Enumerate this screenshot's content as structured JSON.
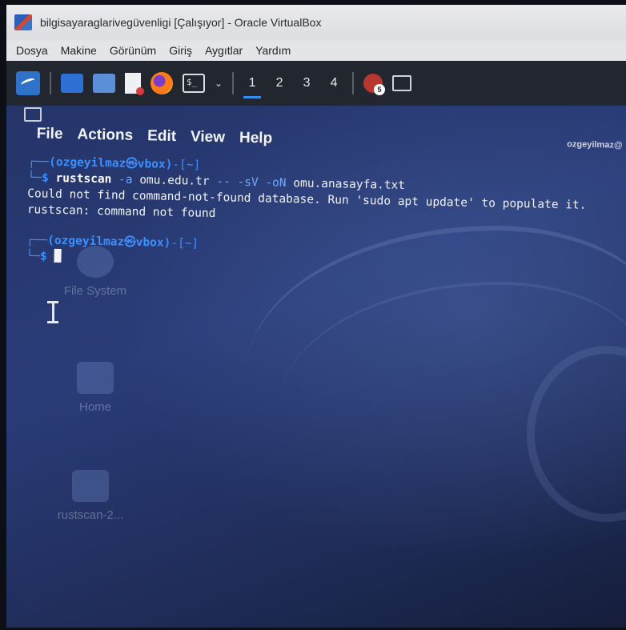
{
  "window": {
    "title": "bilgisayaraglarivegüvenligi [Çalışıyor] - Oracle VirtualBox"
  },
  "vbox_menu": [
    "Dosya",
    "Makine",
    "Görünüm",
    "Giriş",
    "Aygıtlar",
    "Yardım"
  ],
  "panel": {
    "workspaces": [
      "1",
      "2",
      "3",
      "4"
    ],
    "active_workspace": "1",
    "task_badge": "5",
    "terminal_glyph": "$_",
    "chevron": "⌄"
  },
  "terminal": {
    "menu": [
      "File",
      "Actions",
      "Edit",
      "View",
      "Help"
    ],
    "tab_user": "ozgeyilmaz@",
    "prompt_user": "(ozgeyilmaz㉿vbox)",
    "prompt_dir": "-[~]",
    "prompt_top_corner": "┌──",
    "prompt_bottom": "└─$ ",
    "command": {
      "cmd": "rustscan",
      "flag_a": " -a",
      "host": " omu.edu.tr",
      "sep": " --",
      "flag_sv": " -sV",
      "flag_on": " -oN",
      "file": " omu.anasayfa.txt"
    },
    "output": [
      "Could not find command-not-found database. Run 'sudo apt update' to populate it.",
      "rustscan: command not found"
    ]
  },
  "desktop_icons": {
    "file_system": "File System",
    "home": "Home",
    "rustscan": "rustscan-2..."
  },
  "colors": {
    "prompt": "#3b8fff",
    "panel": "#22262e",
    "desktop": "#2a3c78"
  }
}
